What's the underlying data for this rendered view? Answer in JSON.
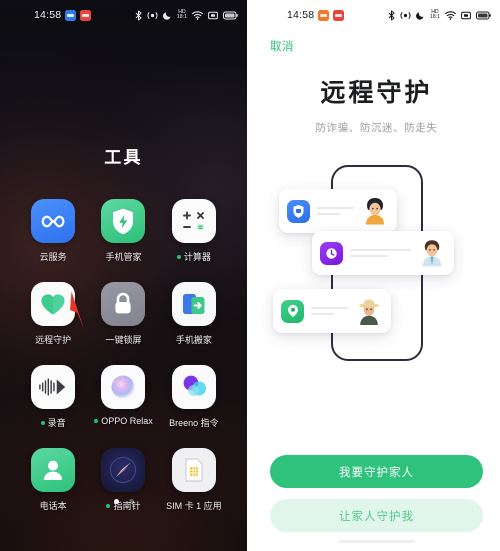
{
  "left_screen": {
    "status_bar": {
      "time": "14:58",
      "left_badges": [
        "app-badge-blue",
        "app-badge-red"
      ],
      "right_icons": [
        "bluetooth-icon",
        "nfc-icon",
        "do-not-disturb-icon",
        "hd-volte-icon",
        "wifi-icon",
        "sim-icon",
        "battery-icon"
      ],
      "volte_label": "HD",
      "volte_sub": "18:1"
    },
    "folder_title": "工具",
    "apps": [
      {
        "label": "云服务",
        "icon": "cloud-service-icon",
        "badge": false
      },
      {
        "label": "手机管家",
        "icon": "phone-manager-icon",
        "badge": false
      },
      {
        "label": "计算器",
        "icon": "calculator-icon",
        "badge": true
      },
      {
        "label": "远程守护",
        "icon": "remote-guardian-icon",
        "badge": false
      },
      {
        "label": "一键锁屏",
        "icon": "lock-screen-icon",
        "badge": false
      },
      {
        "label": "手机搬家",
        "icon": "phone-clone-icon",
        "badge": false
      },
      {
        "label": "录音",
        "icon": "recorder-icon",
        "badge": true
      },
      {
        "label": "OPPO Relax",
        "icon": "oppo-relax-icon",
        "badge": true
      },
      {
        "label": "Breeno 指令",
        "icon": "breeno-command-icon",
        "badge": false
      },
      {
        "label": "电话本",
        "icon": "contacts-icon",
        "badge": false
      },
      {
        "label": "指南针",
        "icon": "compass-icon",
        "badge": true
      },
      {
        "label": "SIM 卡 1 应用",
        "icon": "sim-app-icon",
        "badge": false
      }
    ],
    "pagination": {
      "total": 2,
      "active": 1
    },
    "annotation": {
      "type": "red-arrow",
      "points_to": "远程守护",
      "color": "#e8332a"
    }
  },
  "right_screen": {
    "status_bar": {
      "time": "14:58",
      "left_badges": [
        "app-badge-orange",
        "app-badge-red"
      ],
      "right_icons": [
        "bluetooth-icon",
        "nfc-icon",
        "do-not-disturb-icon",
        "hd-volte-icon",
        "wifi-icon",
        "sim-icon",
        "battery-icon"
      ],
      "volte_label": "HD",
      "volte_sub": "18:1"
    },
    "cancel_label": "取消",
    "title": "远程守护",
    "subtitle": "防诈骗、防沉迷、防走失",
    "illustration": {
      "cards": [
        {
          "icon": "shield-card-icon",
          "avatar": "child-avatar",
          "color": "#2b6fe8"
        },
        {
          "icon": "clock-card-icon",
          "avatar": "man-avatar",
          "color": "#7a17d8"
        },
        {
          "icon": "location-card-icon",
          "avatar": "elder-avatar",
          "color": "#1fb76c"
        }
      ]
    },
    "primary_button": "我要守护家人",
    "secondary_button": "让家人守护我",
    "colors": {
      "accent": "#2ec27c",
      "accent_light": "#e0f6ea",
      "accent_text": "#54c98d"
    }
  }
}
